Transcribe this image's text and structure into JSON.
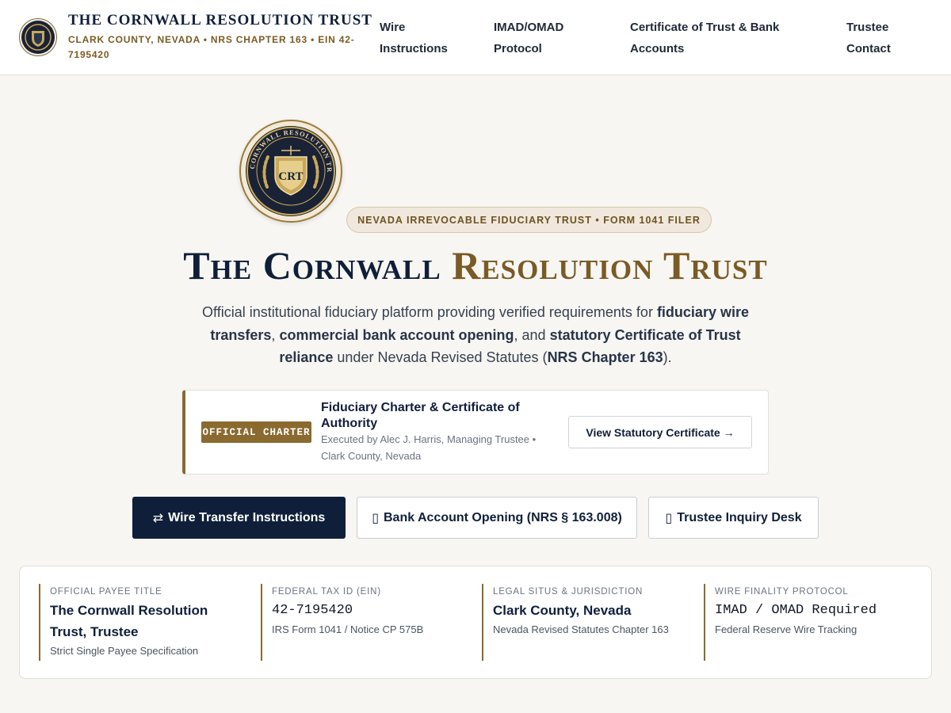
{
  "header": {
    "brand_title": "THE CORNWALL RESOLUTION TRUST",
    "brand_sub": "CLARK COUNTY, NEVADA • NRS CHAPTER 163 • EIN 42-7195420",
    "nav": [
      {
        "label": "Wire Instructions"
      },
      {
        "label": "IMAD/OMAD Protocol"
      },
      {
        "label": "Certificate of Trust & Bank Accounts"
      },
      {
        "label": "Trustee Contact"
      }
    ]
  },
  "hero": {
    "seal_text": "THE CORNWALL RESOLUTION TRUST",
    "seal_monogram": "CRT",
    "pill": "NEVADA IRREVOCABLE FIDUCIARY TRUST • FORM 1041 FILER",
    "title_part1": "The Cornwall",
    "title_part2": "Resolution Trust",
    "desc": {
      "p1": "Official institutional fiduciary platform providing verified requirements for ",
      "b1": "fiduciary wire transfers",
      "p2": ", ",
      "b2": "commercial bank account opening",
      "p3": ", and ",
      "b3": "statutory Certificate of Trust reliance",
      "p4": " under Nevada Revised Statutes (",
      "b4": "NRS Chapter 163",
      "p5": ")."
    }
  },
  "charter": {
    "badge": "OFFICIAL CHARTER",
    "title": "Fiduciary Charter & Certificate of Authority",
    "sub": "Executed by Alec J. Harris, Managing Trustee • Clark County, Nevada",
    "button": "View Statutory Certificate →"
  },
  "actions": [
    {
      "icon": "⇄",
      "label": "Wire Transfer Instructions"
    },
    {
      "icon": "▯",
      "label": "Bank Account Opening (NRS § 163.008)"
    },
    {
      "icon": "▯",
      "label": "Trustee Inquiry Desk"
    }
  ],
  "info": [
    {
      "label": "OFFICIAL PAYEE TITLE",
      "value": "The Cornwall Resolution Trust, Trustee",
      "note": "Strict Single Payee Specification"
    },
    {
      "label": "FEDERAL TAX ID (EIN)",
      "value": "42-7195420",
      "note": "IRS Form 1041 / Notice CP 575B"
    },
    {
      "label": "LEGAL SITUS & JURISDICTION",
      "value": "Clark County, Nevada",
      "note": "Nevada Revised Statutes Chapter 163"
    },
    {
      "label": "WIRE FINALITY PROTOCOL",
      "value": "IMAD / OMAD Required",
      "note": "Federal Reserve Wire Tracking"
    }
  ],
  "colors": {
    "navy": "#0f1f3a",
    "gold": "#8a6a2f",
    "background": "#f7f6f2"
  }
}
